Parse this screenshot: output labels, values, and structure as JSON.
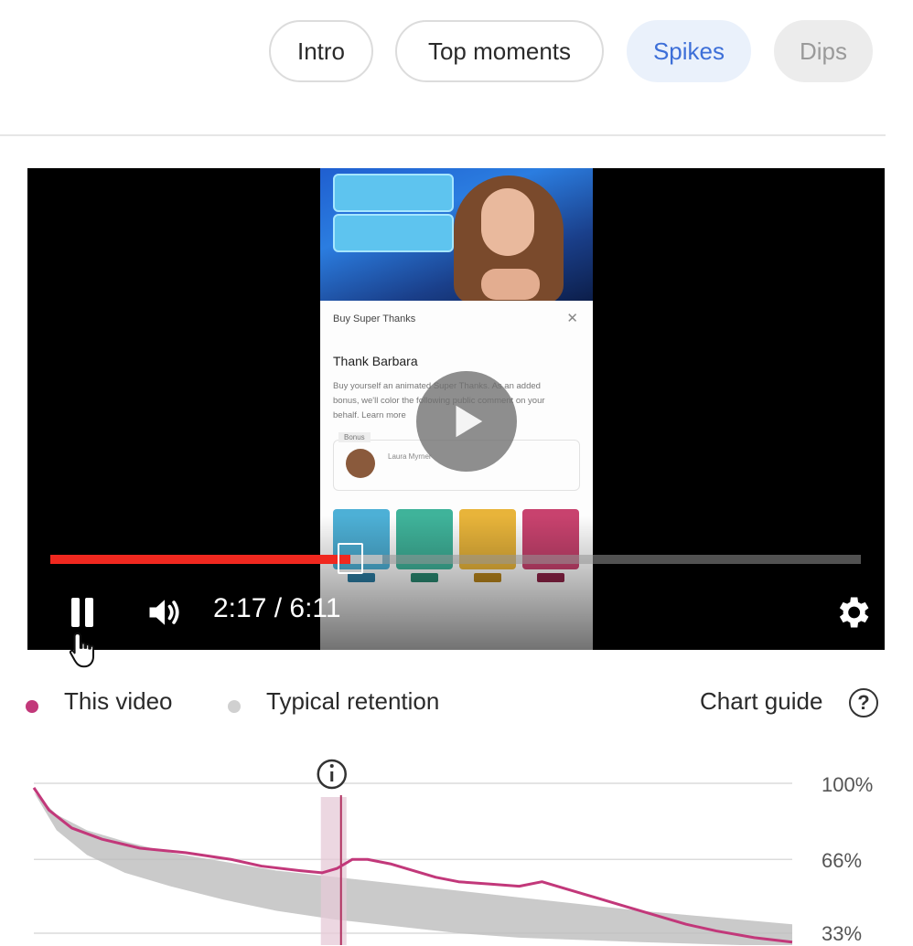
{
  "filters": [
    {
      "label": "Intro",
      "state": "default"
    },
    {
      "label": "Top moments",
      "state": "default"
    },
    {
      "label": "Spikes",
      "state": "active"
    },
    {
      "label": "Dips",
      "state": "disabled"
    }
  ],
  "player": {
    "time": "2:17 / 6:11",
    "progress_fraction": 0.37,
    "buffered_fraction": 0.41,
    "overlay": {
      "sheet_title": "Buy Super Thanks",
      "sheet_name": "Thank Barbara",
      "sheet_desc": "Buy yourself an animated Super Thanks. As an added bonus, we'll color the following public comment on your behalf. Learn more",
      "bonus_tag": "Bonus",
      "bonus_name": "Laura Myrner",
      "tile_colors": [
        "#4db0d6",
        "#3fb39a",
        "#e8b43a",
        "#c8426e"
      ],
      "price_colors": [
        "#2c7da3",
        "#2a8a72",
        "#b9861c",
        "#8e2347"
      ]
    },
    "icons": [
      "pause-icon",
      "volume-icon",
      "settings-gear-icon",
      "play-icon"
    ]
  },
  "legend": {
    "this_video": "This video",
    "typical": "Typical retention",
    "chart_guide": "Chart guide",
    "help_glyph": "?"
  },
  "colors": {
    "this_video": "#c2387a",
    "typical": "#bdbdbd",
    "active_chip_text": "#3d6fd8",
    "progress": "#f0281f"
  },
  "chart_data": {
    "type": "area",
    "ylabels": [
      "100%",
      "66%",
      "33%"
    ],
    "yticks": [
      100,
      66,
      33
    ],
    "ylim": [
      30,
      100
    ],
    "xlim": [
      0,
      100
    ],
    "marker_x": 40.5,
    "marker_icon": "info-icon",
    "series": [
      {
        "name": "This video",
        "x": [
          0,
          2,
          5,
          9,
          14,
          20,
          26,
          30,
          35,
          38,
          40,
          42,
          44,
          47,
          50,
          53,
          56,
          60,
          64,
          67,
          70,
          74,
          78,
          82,
          86,
          90,
          95,
          100
        ],
        "y": [
          98,
          88,
          80,
          75,
          71,
          69,
          66,
          63,
          61,
          60,
          62,
          66,
          66,
          64,
          61,
          58,
          56,
          55,
          54,
          56,
          53,
          49,
          45,
          41,
          37,
          34,
          31,
          29
        ]
      },
      {
        "name": "Typical retention",
        "x": [
          0,
          3,
          7,
          12,
          18,
          25,
          32,
          40,
          48,
          56,
          64,
          72,
          80,
          90,
          100
        ],
        "lower": [
          96,
          79,
          68,
          60,
          54,
          48,
          43,
          39,
          36,
          33,
          31,
          30,
          29,
          28,
          27
        ],
        "upper": [
          96,
          86,
          79,
          74,
          69,
          65,
          61,
          58,
          55,
          52,
          49,
          46,
          43,
          40,
          37
        ]
      }
    ]
  }
}
